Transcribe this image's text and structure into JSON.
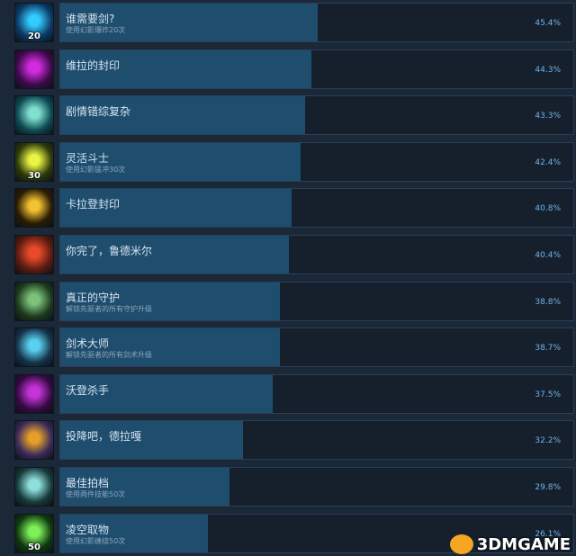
{
  "achievements": [
    {
      "name": "谁需要剑?",
      "desc": "使用幻影爆炸20次",
      "percent": "45.4%",
      "badge": "20",
      "icon": "blue-blast-icon",
      "colors": [
        "#0c3a66",
        "#33ccff"
      ]
    },
    {
      "name": "维拉的封印",
      "desc": "",
      "percent": "44.3%",
      "badge": "",
      "icon": "purple-seal-icon",
      "colors": [
        "#3c0a4a",
        "#d22bdf"
      ]
    },
    {
      "name": "剧情错综复杂",
      "desc": "",
      "percent": "43.3%",
      "badge": "",
      "icon": "teal-fairy-icon",
      "colors": [
        "#0d4a52",
        "#7fe0d0"
      ]
    },
    {
      "name": "灵活斗士",
      "desc": "使用幻影猛冲30次",
      "percent": "42.4%",
      "badge": "30",
      "icon": "yellow-dash-icon",
      "colors": [
        "#2d3a0a",
        "#e9f542"
      ]
    },
    {
      "name": "卡拉登封印",
      "desc": "",
      "percent": "40.8%",
      "badge": "",
      "icon": "golden-seal-icon",
      "colors": [
        "#2a1c05",
        "#f2c230"
      ]
    },
    {
      "name": "你完了，鲁德米尔",
      "desc": "",
      "percent": "40.4%",
      "badge": "",
      "icon": "red-beast-icon",
      "colors": [
        "#5a1a10",
        "#e84a2a"
      ]
    },
    {
      "name": "真正的守护",
      "desc": "解锁先驱者的所有守护升级",
      "percent": "38.8%",
      "badge": "",
      "icon": "shield-spike-icon",
      "colors": [
        "#1d3a1d",
        "#7cc27c"
      ]
    },
    {
      "name": "剑术大师",
      "desc": "解锁先驱者的所有剑术升级",
      "percent": "38.7%",
      "badge": "",
      "icon": "blue-sword-icon",
      "colors": [
        "#15334a",
        "#5ad0f0"
      ]
    },
    {
      "name": "沃登杀手",
      "desc": "",
      "percent": "37.5%",
      "badge": "",
      "icon": "purple-swirl-icon",
      "colors": [
        "#340a42",
        "#c634d8"
      ]
    },
    {
      "name": "投降吧，德拉嘎",
      "desc": "",
      "percent": "32.2%",
      "badge": "",
      "icon": "dragon-boss-icon",
      "colors": [
        "#3a2a5a",
        "#e6a028"
      ]
    },
    {
      "name": "最佳拍档",
      "desc": "使用两件技能50次",
      "percent": "29.8%",
      "badge": "",
      "icon": "cyan-50-icon",
      "colors": [
        "#163a3a",
        "#8fdede"
      ]
    },
    {
      "name": "凌空取物",
      "desc": "使用幻影缠绕50次",
      "percent": "26.1%",
      "badge": "50",
      "icon": "green-hook-icon",
      "colors": [
        "#0f3a10",
        "#7ef05a"
      ]
    }
  ],
  "watermark": "3DMGAME"
}
